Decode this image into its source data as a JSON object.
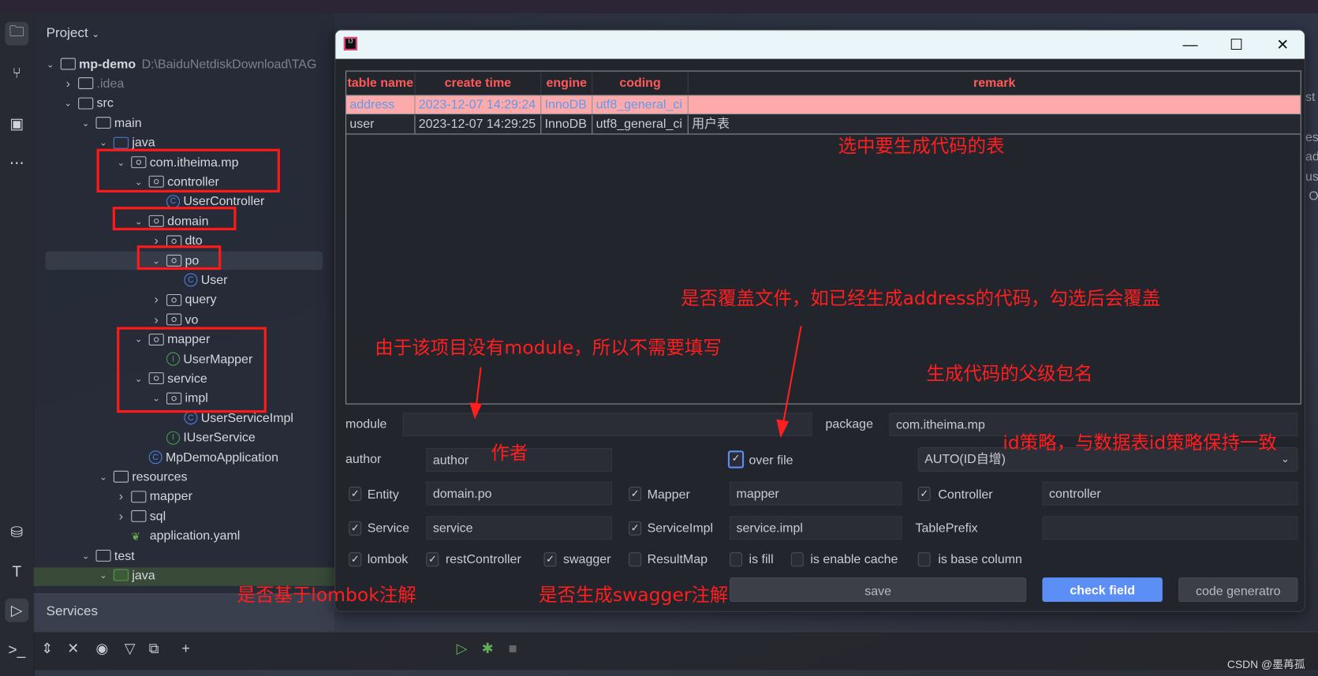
{
  "ide": {
    "project_title": "Project",
    "services_title": "Services",
    "watermark": "CSDN @墨苒孤",
    "right_fragments": [
      "st",
      "es",
      "ad",
      "us",
      "O"
    ],
    "tree": [
      {
        "label": "mp-demo",
        "level": 0,
        "state": "open",
        "icon": "module-folder",
        "suffix": "D:\\BaiduNetdiskDownload\\TAG"
      },
      {
        "label": ".idea",
        "level": 1,
        "state": "closed",
        "icon": "folder",
        "dim": true
      },
      {
        "label": "src",
        "level": 1,
        "state": "open",
        "icon": "folder"
      },
      {
        "label": "main",
        "level": 2,
        "state": "open",
        "icon": "folder"
      },
      {
        "label": "java",
        "level": 3,
        "state": "open",
        "icon": "source-folder"
      },
      {
        "label": "com.itheima.mp",
        "level": 4,
        "state": "open",
        "icon": "package"
      },
      {
        "label": "controller",
        "level": 5,
        "state": "open",
        "icon": "package"
      },
      {
        "label": "UserController",
        "level": 6,
        "state": "leaf",
        "icon": "class"
      },
      {
        "label": "domain",
        "level": 5,
        "state": "open",
        "icon": "package"
      },
      {
        "label": "dto",
        "level": 6,
        "state": "closed",
        "icon": "package"
      },
      {
        "label": "po",
        "level": 6,
        "state": "open",
        "icon": "package"
      },
      {
        "label": "User",
        "level": 7,
        "state": "leaf",
        "icon": "class"
      },
      {
        "label": "query",
        "level": 6,
        "state": "closed",
        "icon": "package"
      },
      {
        "label": "vo",
        "level": 6,
        "state": "closed",
        "icon": "package"
      },
      {
        "label": "mapper",
        "level": 5,
        "state": "open",
        "icon": "package"
      },
      {
        "label": "UserMapper",
        "level": 6,
        "state": "leaf",
        "icon": "interface"
      },
      {
        "label": "service",
        "level": 5,
        "state": "open",
        "icon": "package"
      },
      {
        "label": "impl",
        "level": 6,
        "state": "open",
        "icon": "package"
      },
      {
        "label": "UserServiceImpl",
        "level": 7,
        "state": "leaf",
        "icon": "class"
      },
      {
        "label": "IUserService",
        "level": 6,
        "state": "leaf",
        "icon": "interface"
      },
      {
        "label": "MpDemoApplication",
        "level": 5,
        "state": "leaf",
        "icon": "spring-class"
      },
      {
        "label": "resources",
        "level": 3,
        "state": "open",
        "icon": "resources-folder"
      },
      {
        "label": "mapper",
        "level": 4,
        "state": "closed",
        "icon": "folder"
      },
      {
        "label": "sql",
        "level": 4,
        "state": "closed",
        "icon": "folder"
      },
      {
        "label": "application.yaml",
        "level": 4,
        "state": "leaf",
        "icon": "spring-yaml"
      },
      {
        "label": "test",
        "level": 2,
        "state": "open",
        "icon": "folder"
      },
      {
        "label": "java",
        "level": 3,
        "state": "open",
        "icon": "test-folder"
      }
    ]
  },
  "dialog": {
    "table": {
      "columns": [
        "table name",
        "create time",
        "engine",
        "coding",
        "remark"
      ],
      "rows": [
        {
          "table_name": "address",
          "create_time": "2023-12-07 14:29:24",
          "engine": "InnoDB",
          "coding": "utf8_general_ci",
          "remark": "",
          "selected": true
        },
        {
          "table_name": "user",
          "create_time": "2023-12-07 14:29:25",
          "engine": "InnoDB",
          "coding": "utf8_general_ci",
          "remark": "用户表",
          "selected": false
        }
      ]
    },
    "form": {
      "module_label": "module",
      "module_value": "",
      "package_label": "package",
      "package_value": "com.itheima.mp",
      "author_label": "author",
      "author_value": "author",
      "over_file_label": "over file",
      "over_file_checked": true,
      "id_strategy": "AUTO(ID自增)",
      "entity_label": "Entity",
      "entity_checked": true,
      "entity_value": "domain.po",
      "mapper_label": "Mapper",
      "mapper_checked": true,
      "mapper_value": "mapper",
      "controller_label": "Controller",
      "controller_checked": true,
      "controller_value": "controller",
      "service_label": "Service",
      "service_checked": true,
      "service_value": "service",
      "serviceimpl_label": "ServiceImpl",
      "serviceimpl_checked": true,
      "serviceimpl_value": "service.impl",
      "tableprefix_label": "TablePrefix",
      "tableprefix_value": "",
      "options": [
        {
          "label": "lombok",
          "checked": true
        },
        {
          "label": "restController",
          "checked": true
        },
        {
          "label": "swagger",
          "checked": true
        },
        {
          "label": "ResultMap",
          "checked": false
        },
        {
          "label": "is fill",
          "checked": false
        },
        {
          "label": "is enable cache",
          "checked": false
        },
        {
          "label": "is base column",
          "checked": false
        }
      ]
    },
    "buttons": {
      "save": "save",
      "check": "check field",
      "generate": "code generatro"
    }
  },
  "annotations": {
    "select_table": "选中要生成代码的表",
    "over_file": "是否覆盖文件，如已经生成address的代码，勾选后会覆盖",
    "module": "由于该项目没有module，所以不需要填写",
    "package": "生成代码的父级包名",
    "author": "作者",
    "id_strategy": "id策略，与数据表id策略保持一致",
    "lombok": "是否基于lombok注解",
    "swagger": "是否生成swagger注解"
  },
  "colors": {
    "accent": "#5b8ff5",
    "selected_row": "#ffaaaa",
    "selected_text": "#5b9bf0",
    "header_text": "#ff5a5a",
    "annotation": "#ff1f1f"
  }
}
